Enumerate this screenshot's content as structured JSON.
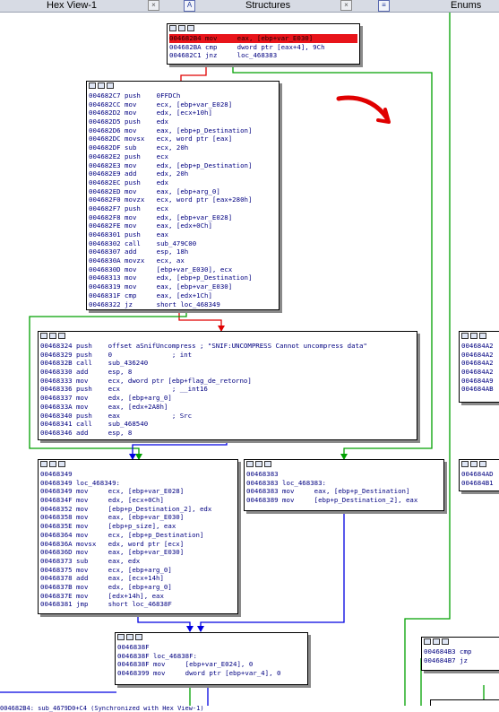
{
  "tabs": [
    {
      "label": "Hex View-1",
      "icon": "hex-view-icon"
    },
    {
      "label": "Structures",
      "icon": "structures-icon"
    },
    {
      "label": "Enums",
      "icon": "enums-icon"
    }
  ],
  "close_glyph": "×",
  "colors": {
    "edge_true": "#00a000",
    "edge_false": "#e00000",
    "edge_jump": "#0000e0",
    "highlight": "#e8141a",
    "code": "#000080",
    "annotation": "#e00000"
  },
  "nodes": {
    "n1": [
      "004682B4 mov     eax, [ebp+var_E030]",
      "004682BA cmp     dword ptr [eax+4], 9Ch",
      "004682C1 jnz     loc_468383"
    ],
    "n2": [
      "004682C7 push    0FFDCh",
      "004682CC mov     ecx, [ebp+var_E028]",
      "004682D2 mov     edx, [ecx+10h]",
      "004682D5 push    edx",
      "004682D6 mov     eax, [ebp+p_Destination]",
      "004682DC movsx   ecx, word ptr [eax]",
      "004682DF sub     ecx, 20h",
      "004682E2 push    ecx",
      "004682E3 mov     edx, [ebp+p_Destination]",
      "004682E9 add     edx, 20h",
      "004682EC push    edx",
      "004682ED mov     eax, [ebp+arg_0]",
      "004682F0 movzx   ecx, word ptr [eax+280h]",
      "004682F7 push    ecx",
      "004682F8 mov     edx, [ebp+var_E028]",
      "004682FE mov     eax, [edx+0Ch]",
      "00468301 push    eax",
      "00468302 call    sub_479C00",
      "00468307 add     esp, 18h",
      "0046830A movzx   ecx, ax",
      "0046830D mov     [ebp+var_E030], ecx",
      "00468313 mov     edx, [ebp+p_Destination]",
      "00468319 mov     eax, [ebp+var_E030]",
      "0046831F cmp     eax, [edx+1Ch]",
      "00468322 jz      short loc_468349"
    ],
    "n3": [
      "00468324 push    offset aSnifUncompress ; \"SNIF:UNCOMPRESS Cannot uncompress data\"",
      "00468329 push    0               ; int",
      "0046832B call    sub_436240",
      "00468330 add     esp, 8",
      "00468333 mov     ecx, dword ptr [ebp+flag_de_retorno]",
      "00468336 push    ecx             ; __int16",
      "00468337 mov     edx, [ebp+arg_0]",
      "0046833A mov     eax, [edx+2A8h]",
      "00468340 push    eax             ; Src",
      "00468341 call    sub_468540",
      "00468346 add     esp, 8"
    ],
    "n4": [
      "00468349",
      "00468349 loc_468349:",
      "00468349 mov     ecx, [ebp+var_E028]",
      "0046834F mov     edx, [ecx+0Ch]",
      "00468352 mov     [ebp+p_Destination_2], edx",
      "00468358 mov     eax, [ebp+var_E030]",
      "0046835E mov     [ebp+p_size], eax",
      "00468364 mov     ecx, [ebp+p_Destination]",
      "0046836A movsx   edx, word ptr [ecx]",
      "0046836D mov     eax, [ebp+var_E030]",
      "00468373 sub     eax, edx",
      "00468375 mov     ecx, [ebp+arg_0]",
      "00468378 add     eax, [ecx+14h]",
      "0046837B mov     edx, [ebp+arg_0]",
      "0046837E mov     [edx+14h], eax",
      "00468381 jmp     short loc_46838F"
    ],
    "n5": [
      "00468383",
      "00468383 loc_468383:",
      "00468383 mov     eax, [ebp+p_Destination]",
      "00468389 mov     [ebp+p_Destination_2], eax"
    ],
    "n6": [
      "0046838F",
      "0046838F loc_46838F:",
      "0046838F mov     [ebp+var_E024], 0",
      "00468399 mov     dword ptr [ebp+var_4], 0"
    ],
    "n7": [
      "004684A2",
      "004684A2",
      "004684A2",
      "004684A2",
      "004684A9",
      "004684AB"
    ],
    "n8": [
      "004684AD",
      "004684B1"
    ],
    "n9": [
      "004684B3 cmp",
      "004684B7 jz"
    ]
  },
  "status_line": "004682B4: sub_4679D0+C4 (Synchronized with Hex View-1)"
}
